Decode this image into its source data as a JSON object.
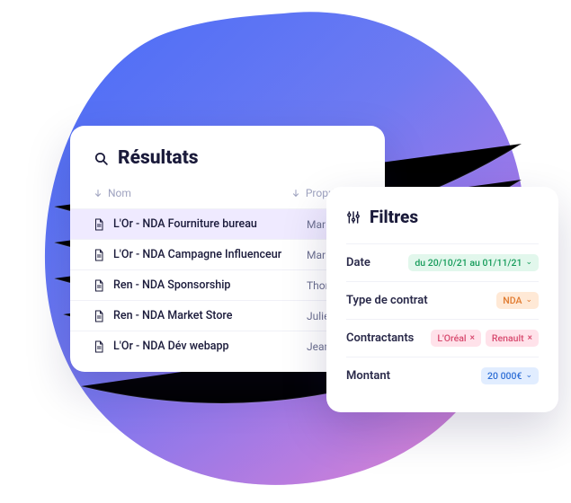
{
  "results": {
    "title": "Résultats",
    "columns": {
      "name": "Nom",
      "owner": "Propriétaire"
    },
    "rows": [
      {
        "name": "L'Or - NDA Fourniture bureau",
        "owner": "Marie",
        "selected": true
      },
      {
        "name": "L'Or - NDA Campagne Influenceur",
        "owner": "Marie",
        "selected": false
      },
      {
        "name": "Ren - NDA Sponsorship",
        "owner": "Thom",
        "selected": false
      },
      {
        "name": "Ren - NDA Market Store",
        "owner": "Julie",
        "selected": false
      },
      {
        "name": "L'Or - NDA Dév webapp",
        "owner": "Jean",
        "selected": false
      }
    ]
  },
  "filters": {
    "title": "Filtres",
    "items": {
      "date": {
        "label": "Date",
        "chip": "du 20/10/21 au 01/11/21"
      },
      "contractType": {
        "label": "Type de contrat",
        "chip": "NDA"
      },
      "contractors": {
        "label": "Contractants",
        "chip1": "L'Oréal",
        "chip2": "Renault"
      },
      "amount": {
        "label": "Montant",
        "chip": "20 000€"
      }
    }
  }
}
